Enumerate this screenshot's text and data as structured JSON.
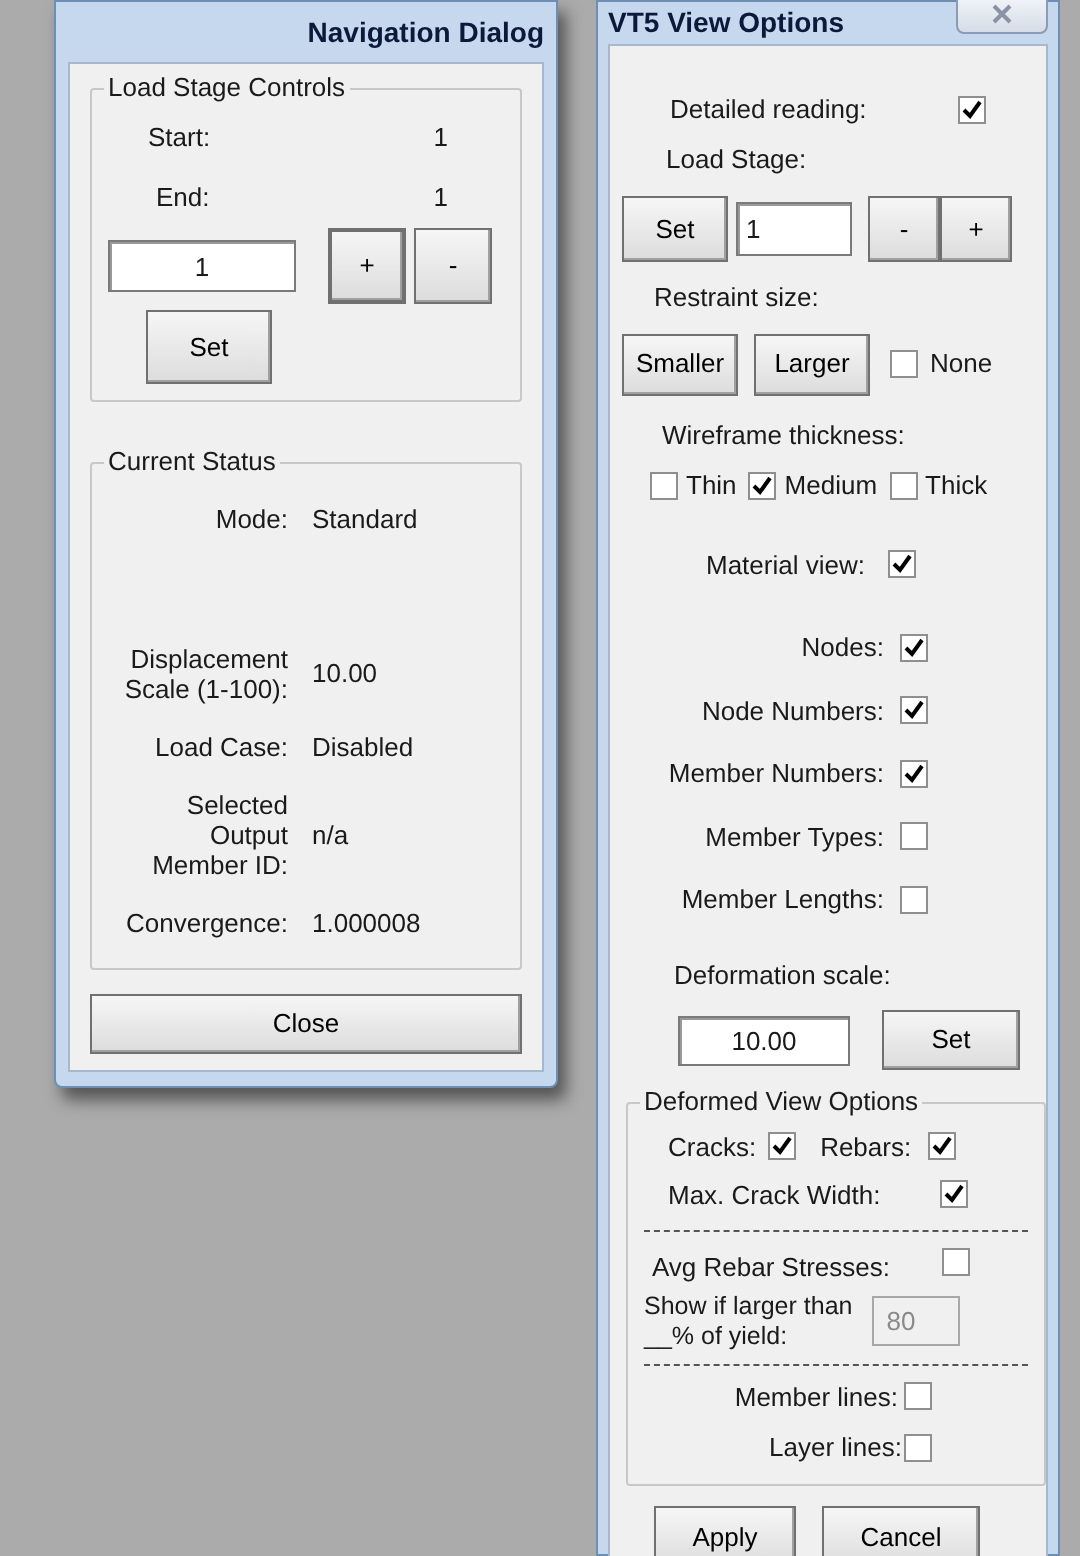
{
  "navigation_dialog": {
    "title": "Navigation Dialog",
    "load_stage_controls": {
      "title": "Load Stage Controls",
      "start_label": "Start:",
      "start_value": "1",
      "end_label": "End:",
      "end_value": "1",
      "stage_value": "1",
      "plus": "+",
      "minus": "-",
      "set": "Set"
    },
    "current_status": {
      "title": "Current Status",
      "rows": [
        {
          "label": "Mode:",
          "value": "Standard"
        },
        {
          "label": "Displacement\nScale (1-100):",
          "value": "10.00"
        },
        {
          "label": "Load Case:",
          "value": "Disabled"
        },
        {
          "label": "Selected\nOutput\nMember ID:",
          "value": "n/a"
        },
        {
          "label": "Convergence:",
          "value": "1.000008"
        }
      ]
    },
    "close": "Close"
  },
  "view_options": {
    "title": "VT5 View Options",
    "detailed_reading": {
      "label": "Detailed reading:",
      "checked": true
    },
    "load_stage": {
      "label": "Load Stage:",
      "set": "Set",
      "value": "1",
      "minus": "-",
      "plus": "+"
    },
    "restraint_size": {
      "label": "Restraint size:",
      "smaller": "Smaller",
      "larger": "Larger",
      "none": {
        "label": "None",
        "checked": false
      }
    },
    "wireframe_thickness": {
      "label": "Wireframe thickness:",
      "options": [
        {
          "label": "Thin",
          "checked": false
        },
        {
          "label": "Medium",
          "checked": true
        },
        {
          "label": "Thick",
          "checked": false
        }
      ]
    },
    "material_view": {
      "label": "Material view:",
      "checked": true
    },
    "display_options": [
      {
        "label": "Nodes:",
        "checked": true
      },
      {
        "label": "Node Numbers:",
        "checked": true
      },
      {
        "label": "Member Numbers:",
        "checked": true
      },
      {
        "label": "Member Types:",
        "checked": false
      },
      {
        "label": "Member Lengths:",
        "checked": false
      }
    ],
    "deformation_scale": {
      "label": "Deformation scale:",
      "value": "10.00",
      "set": "Set"
    },
    "deformed_view_options": {
      "title": "Deformed View Options",
      "cracks": {
        "label": "Cracks:",
        "checked": true
      },
      "rebars": {
        "label": "Rebars:",
        "checked": true
      },
      "max_crack_width": {
        "label": "Max. Crack Width:",
        "checked": true
      },
      "avg_rebar_stresses": {
        "label": "Avg Rebar Stresses:",
        "checked": false
      },
      "yield_threshold": {
        "label": "Show if larger than\n__% of yield:",
        "value": "80",
        "disabled": true
      },
      "member_lines": {
        "label": "Member lines:",
        "checked": false
      },
      "layer_lines": {
        "label": "Layer lines:",
        "checked": false
      }
    },
    "apply": "Apply",
    "cancel": "Cancel"
  }
}
